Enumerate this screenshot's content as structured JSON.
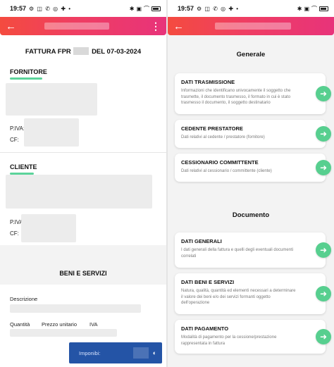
{
  "status": {
    "time": "19:57",
    "left_icons": "⚙ ◫ ✆ ◎ ✚ •",
    "right_icons": "✱ ▣ ⌒"
  },
  "left": {
    "title_pre": "FATTURA FPR",
    "title_post": "DEL 07-03-2024",
    "fornitore": {
      "heading": "FORNITORE",
      "piva_label": "P.IVA:",
      "cf_label": "CF:"
    },
    "cliente": {
      "heading": "CLIENTE",
      "piva_label": "P.IVA:",
      "cf_label": "CF:"
    },
    "beni": {
      "heading": "BENI E SERVIZI",
      "descrizione": "Descrizione",
      "quantita": "Quantità",
      "prezzo": "Prezzo unitario",
      "iva": "IVA"
    },
    "toast": {
      "label": "Imponibi:"
    }
  },
  "right": {
    "groups": [
      {
        "title": "Generale",
        "cards": [
          {
            "title": "DATI TRASMISSIONE",
            "desc": "Informazioni che identificano univocamente il soggetto che trasmette, il documento trasmesso, il formato in cui è stato trasmesso il documento, il soggetto destinatario"
          },
          {
            "title": "CEDENTE PRESTATORE",
            "desc": "Dati relativi al cedente / prestatore (fornitore)"
          },
          {
            "title": "CESSIONARIO COMMITTENTE",
            "desc": "Dati relativi al cessionario / committente (cliente)"
          }
        ]
      },
      {
        "title": "Documento",
        "cards": [
          {
            "title": "DATI GENERALI",
            "desc": "I dati generali della fattura e quelli degli eventuali documenti correlati"
          },
          {
            "title": "DATI BENI E SERVIZI",
            "desc": "Natura, qualità, quantità ed elementi necessari a determinare il valore dei beni e/o dei servizi formanti oggetto dell'operazione"
          },
          {
            "title": "DATI PAGAMENTO",
            "desc": "Modalità di pagamento per la cessione/prestazione rappresentata in fattura"
          }
        ]
      }
    ]
  },
  "colors": {
    "accent_green": "#57cf8f",
    "appbar_start": "#f44b3f",
    "appbar_end": "#e8337a",
    "toast": "#2454a6"
  }
}
